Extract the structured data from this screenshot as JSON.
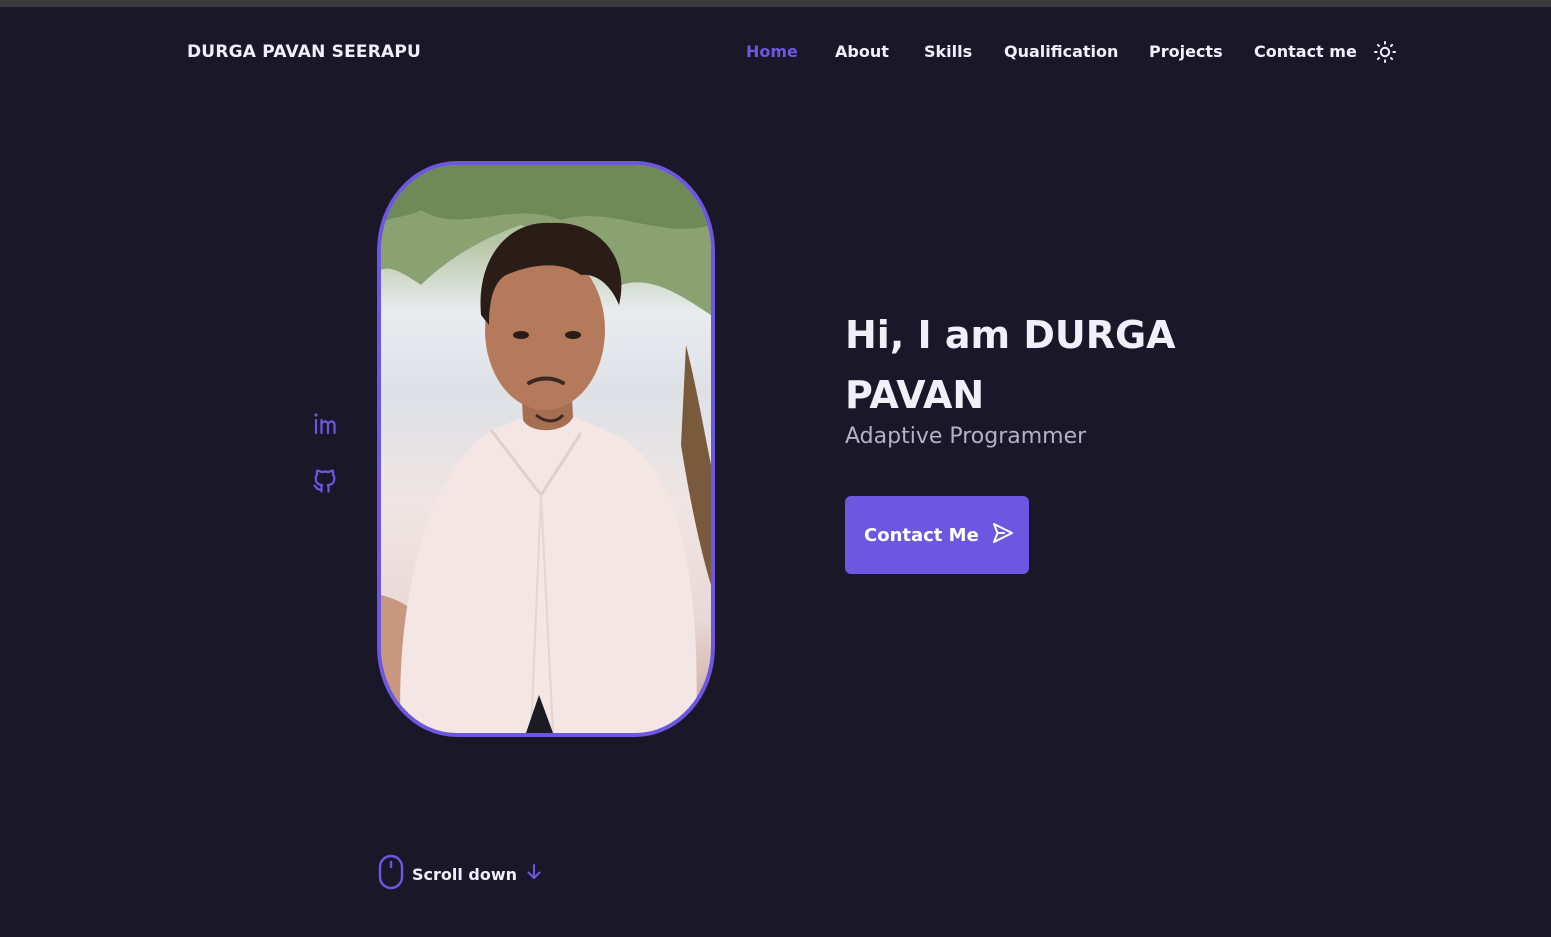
{
  "header": {
    "logo": "DURGA PAVAN SEERAPU",
    "nav": [
      {
        "label": "Home",
        "active": true
      },
      {
        "label": "About",
        "active": false
      },
      {
        "label": "Skills",
        "active": false
      },
      {
        "label": "Qualification",
        "active": false
      },
      {
        "label": "Projects",
        "active": false
      },
      {
        "label": "Contact me",
        "active": false
      }
    ],
    "theme_icon": "sun-icon"
  },
  "social": [
    {
      "icon": "linkedin-icon"
    },
    {
      "icon": "github-icon"
    }
  ],
  "hero": {
    "title": "Hi, I am DURGA PAVAN",
    "subtitle": "Adaptive Programmer",
    "contact_button": "Contact Me",
    "contact_icon": "send-icon"
  },
  "scroll": {
    "label": "Scroll down",
    "icon": "mouse-icon",
    "arrow_icon": "arrow-down-icon"
  },
  "colors": {
    "background": "#1a1729",
    "accent": "#6e57e0",
    "text": "#f1eff8",
    "muted_text": "#b5b0c9"
  }
}
